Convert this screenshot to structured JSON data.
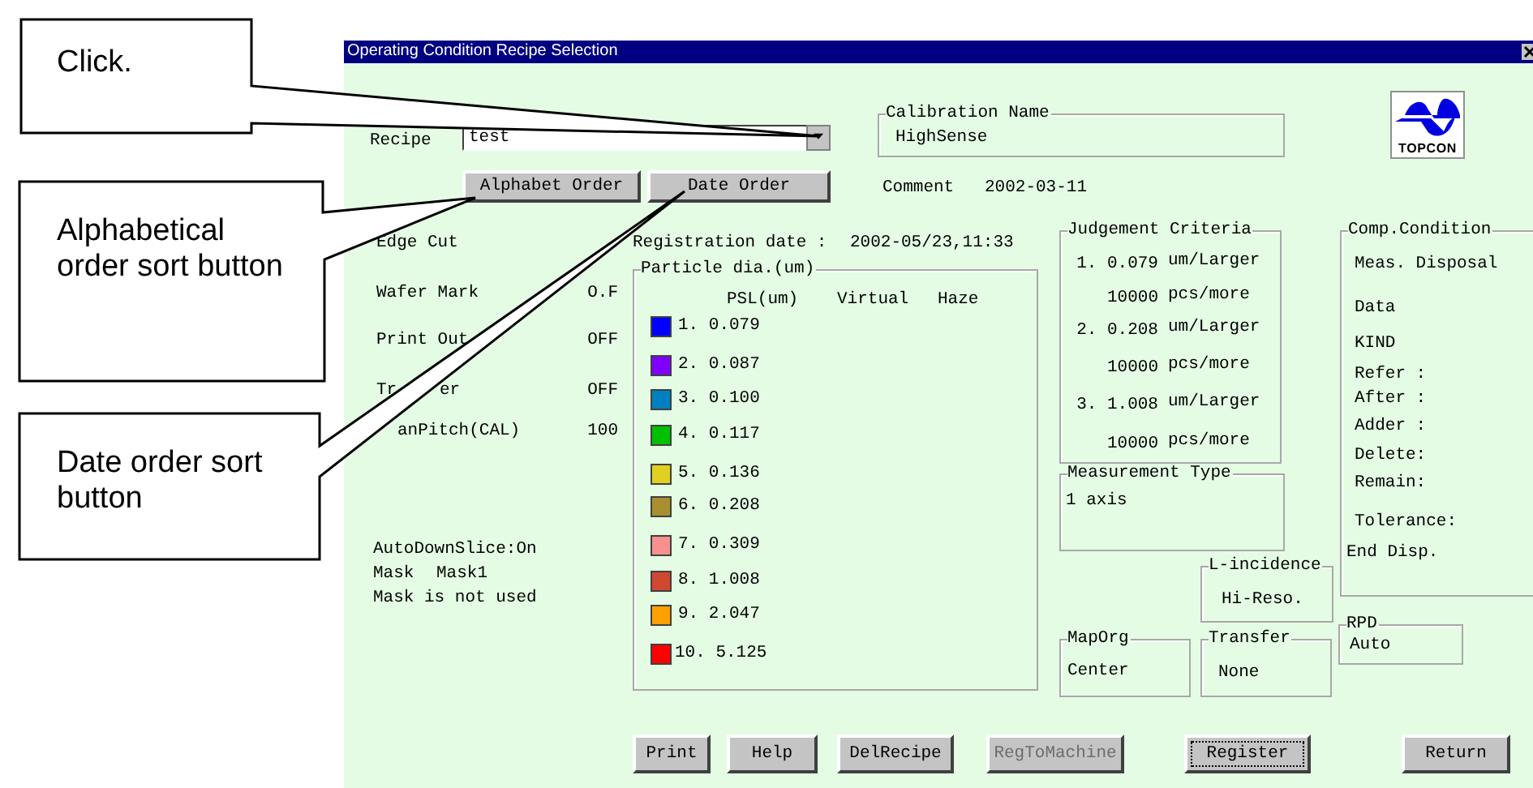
{
  "window": {
    "title": "Operating Condition Recipe Selection"
  },
  "recipe": {
    "label": "Recipe",
    "value": "test"
  },
  "sort_buttons": [
    {
      "label": "Alphabet Order"
    },
    {
      "label": "Date Order"
    }
  ],
  "calibration": {
    "title": "Calibration Name",
    "value": "HighSense"
  },
  "logo": {
    "text": "TOPCON"
  },
  "comment": {
    "label": "Comment",
    "value": "2002-03-11"
  },
  "settings": [
    {
      "label": "Edge Cut"
    },
    {
      "label": "Wafer Mark",
      "value": "O.F"
    },
    {
      "label": "Print Out",
      "value": "OFF"
    },
    {
      "label": "Tr",
      "label_tail": "er",
      "value": "OFF"
    },
    {
      "label": "anPitch(CAL)",
      "value": "100"
    }
  ],
  "notes": [
    {
      "text": "AutoDownSlice:On"
    },
    {
      "text": "Mask",
      "value": "Mask1"
    },
    {
      "text": "Mask is not used"
    }
  ],
  "registration": {
    "label": "Registration date :",
    "value": "2002-05/23,11:33"
  },
  "particle": {
    "title": "Particle dia.(um)",
    "columns": [
      "PSL(um)",
      "Virtual",
      "Haze"
    ],
    "rows": [
      {
        "text": "1. 0.079",
        "color": "#0000ff"
      },
      {
        "text": "2. 0.087",
        "color": "#8000ff"
      },
      {
        "text": "3. 0.100",
        "color": "#0080c0"
      },
      {
        "text": "4. 0.117",
        "color": "#00c000"
      },
      {
        "text": "5. 0.136",
        "color": "#e0d020"
      },
      {
        "text": "6. 0.208",
        "color": "#a89030"
      },
      {
        "text": "7. 0.309",
        "color": "#f89090"
      },
      {
        "text": "8. 1.008",
        "color": "#d04830"
      },
      {
        "text": "9. 2.047",
        "color": "#ffa000"
      },
      {
        "text": "10. 5.125",
        "color": "#ff0000"
      }
    ]
  },
  "judgement": {
    "title": "Judgement Criteria",
    "rows": [
      {
        "value": "1. 0.079",
        "unit": "um/Larger"
      },
      {
        "value": "10000",
        "unit": "pcs/more"
      },
      {
        "value": "2. 0.208",
        "unit": "um/Larger"
      },
      {
        "value": "10000",
        "unit": "pcs/more"
      },
      {
        "value": "3. 1.008",
        "unit": "um/Larger"
      },
      {
        "value": "10000",
        "unit": "pcs/more"
      }
    ]
  },
  "comp_condition": {
    "title": "Comp.Condition",
    "items": [
      "Meas. Disposal",
      "Data",
      "KIND",
      "Refer :",
      "After :",
      "Adder :",
      "Delete:",
      "Remain:",
      "Tolerance:",
      "End Disp."
    ]
  },
  "measurement_type": {
    "title": "Measurement Type",
    "value": "1 axis"
  },
  "l_incidence": {
    "title": "L-incidence",
    "value": "Hi-Reso."
  },
  "rpd": {
    "title": "RPD",
    "value": "Auto"
  },
  "map_org": {
    "title": "MapOrg",
    "value": "Center"
  },
  "transfer": {
    "title": "Transfer",
    "value": "None"
  },
  "buttons": [
    {
      "label": "Print",
      "disabled": false,
      "focused": false
    },
    {
      "label": "Help",
      "disabled": false,
      "focused": false
    },
    {
      "label": "DelRecipe",
      "disabled": false,
      "focused": false
    },
    {
      "label": "RegToMachine",
      "disabled": true,
      "focused": false
    },
    {
      "label": "Register",
      "disabled": false,
      "focused": true
    },
    {
      "label": "Return",
      "disabled": false,
      "focused": false
    }
  ],
  "callouts": [
    {
      "text": "Click."
    },
    {
      "text": "Alphabetical order sort button"
    },
    {
      "text": "Date order sort button"
    }
  ]
}
